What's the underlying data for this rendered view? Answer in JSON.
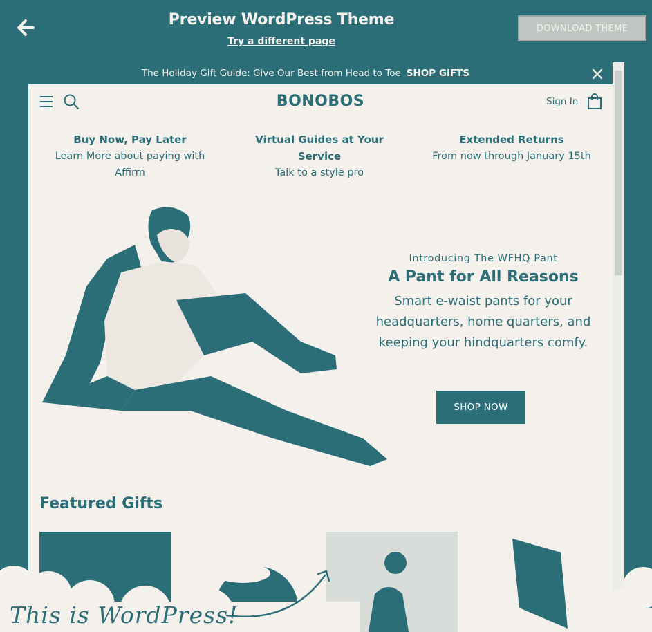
{
  "preview_bar": {
    "title": "Preview WordPress Theme",
    "subtitle_link": "Try a different page",
    "download_button": "DOWNLOAD THEME",
    "back_icon": "arrow-left-icon"
  },
  "announcement": {
    "text": "The Holiday Gift Guide: Give Our Best from Head to Toe",
    "link": "SHOP GIFTS",
    "close_icon": "close-icon"
  },
  "site": {
    "logo": "BONOBOS",
    "sign_in": "Sign In",
    "usps": [
      {
        "heading": "Buy Now, Pay Later",
        "text": "Learn More about paying with Affirm"
      },
      {
        "heading": "Virtual Guides at Your Service",
        "text": "Talk to a style pro"
      },
      {
        "heading": "Extended Returns",
        "text": "From now through January 15th"
      }
    ],
    "hero": {
      "eyebrow": "Introducing The WFHQ Pant",
      "title": "A Pant for All Reasons",
      "body": "Smart e-waist pants for your headquarters, home quarters, and keeping your hindquarters comfy.",
      "button": "SHOP NOW"
    },
    "featured_title": "Featured Gifts"
  },
  "overlay": {
    "caption": "This is WordPress!"
  },
  "colors": {
    "teal": "#2b6e78",
    "cream": "#f4f1ec"
  }
}
